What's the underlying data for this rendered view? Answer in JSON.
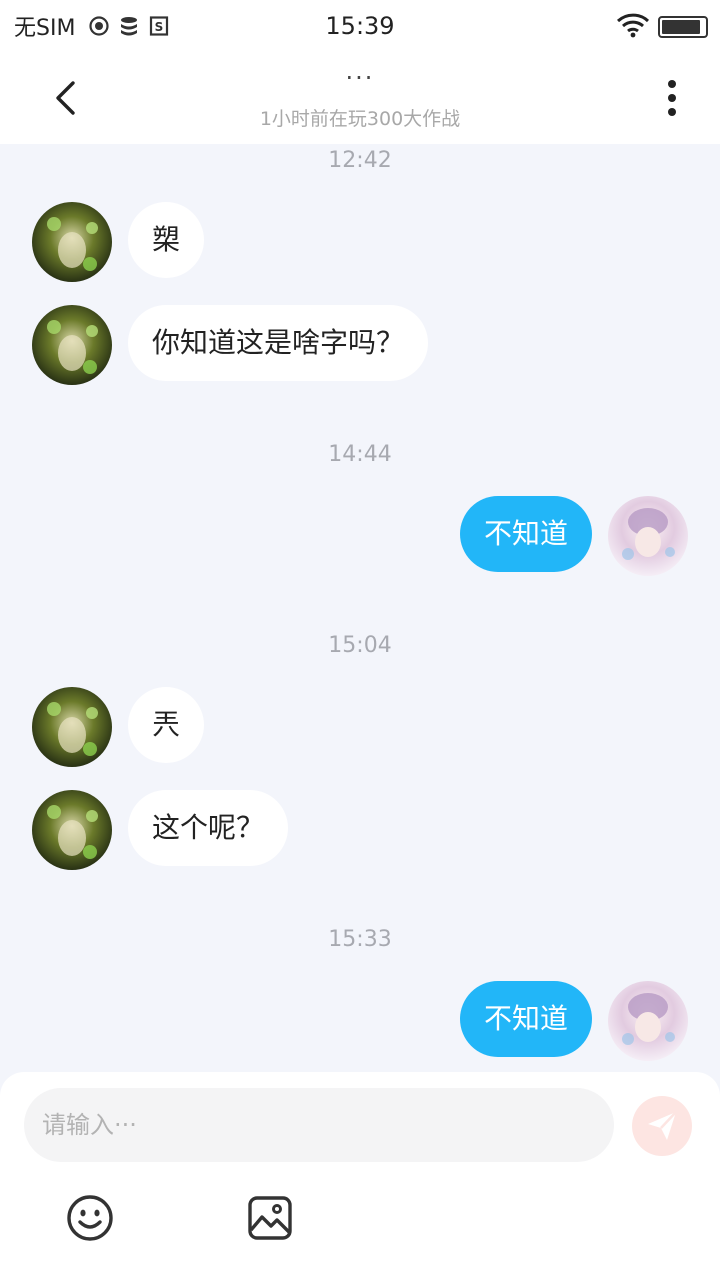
{
  "status_bar": {
    "carrier": "无SIM",
    "time": "15:39",
    "icons": [
      "media-icon",
      "data-icon",
      "storage-icon",
      "wifi-icon",
      "battery-icon"
    ]
  },
  "header": {
    "title": "···",
    "subtitle": "1小时前在玩300大作战",
    "back_icon": "chevron-left-icon",
    "more_icon": "more-vertical-icon"
  },
  "messages": [
    {
      "type": "time",
      "text": "12:42"
    },
    {
      "type": "incoming",
      "text": "槊"
    },
    {
      "type": "incoming",
      "text": "你知道这是啥字吗？"
    },
    {
      "type": "time",
      "text": "14:44"
    },
    {
      "type": "outgoing",
      "text": "不知道"
    },
    {
      "type": "time",
      "text": "15:04"
    },
    {
      "type": "incoming",
      "text": "兲"
    },
    {
      "type": "incoming",
      "text": "这个呢？"
    },
    {
      "type": "time",
      "text": "15:33"
    },
    {
      "type": "outgoing",
      "text": "不知道"
    }
  ],
  "input": {
    "placeholder": "请输入···",
    "value": ""
  },
  "toolbar": {
    "send_icon": "send-icon",
    "emoji_icon": "emoji-icon",
    "image_icon": "image-icon"
  },
  "colors": {
    "outgoing_bubble": "#22b6f8",
    "incoming_bubble": "#ffffff",
    "chat_background": "#f3f5fb",
    "send_button": "#fde5e2"
  }
}
